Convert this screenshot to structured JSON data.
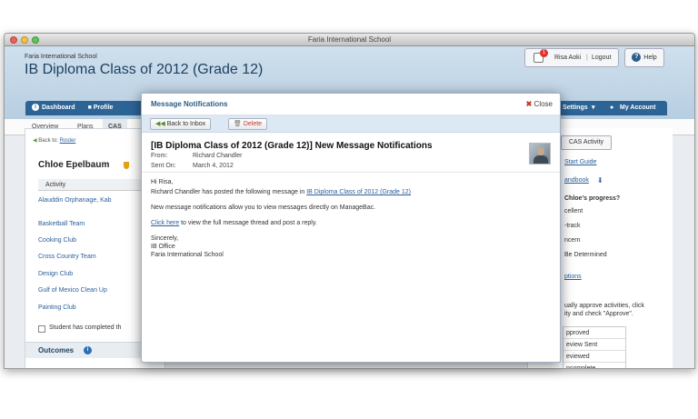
{
  "window": {
    "title": "Faria International School"
  },
  "header": {
    "school": "Faria International School",
    "class_title": "IB Diploma Class of 2012 (Grade 12)",
    "user_name": "Risa Aoki",
    "notif_count": "1",
    "logout": "Logout",
    "help": "Help"
  },
  "nav": {
    "items": [
      "Dashboard",
      "Profile"
    ],
    "right": [
      "Settings",
      "My Account"
    ]
  },
  "subnav": [
    "Overview",
    "Plans",
    "CAS"
  ],
  "left": {
    "back_prefix": "Back to:",
    "back_link": "Roster",
    "student": "Chloe Epelbaum",
    "col_activity": "Activity",
    "activities": [
      "Alauddin Orphanage, Kab",
      "Basketball Team",
      "Cooking Club",
      "Cross Country Team",
      "Design Club",
      "Gulf of Mexico Clean Up",
      "Painting Club"
    ],
    "checkbox": "Student has completed th",
    "outcomes": "Outcomes"
  },
  "right": {
    "btn": "CAS Activity",
    "guide": "Start Guide",
    "handbook": "andbook",
    "progress_q": "Chloe's progress?",
    "opts": [
      "cellent",
      "-track",
      "ncern",
      "Be Determined"
    ],
    "options": "ptions",
    "approve_text1": "ually approve activities, click",
    "approve_text2": "ity and check \"Approve\".",
    "statuses": [
      "pproved",
      "eview Sent",
      "eviewed",
      "ncomplete"
    ]
  },
  "modal": {
    "title": "Message Notifications",
    "close": "Close",
    "back_inbox": "Back to Inbox",
    "delete": "Delete",
    "subject": "[IB Diploma Class of 2012 (Grade 12)] New Message Notifications",
    "from_label": "From:",
    "from": "Richard Chandler",
    "sent_label": "Sent On:",
    "sent": "March 4, 2012",
    "greeting": "Hi Risa,",
    "line1": "Richard Chandler has posted the following message in",
    "line1_link": "IB Diploma Class of 2012 (Grade 12)",
    "line2": "New message notifications allow you to view messages directly on ManageBac.",
    "click_here": "Click here",
    "line3": "to view the full message thread and post a reply.",
    "sign1": "Sincerely,",
    "sign2": "IB Office",
    "sign3": "Faria International School"
  }
}
